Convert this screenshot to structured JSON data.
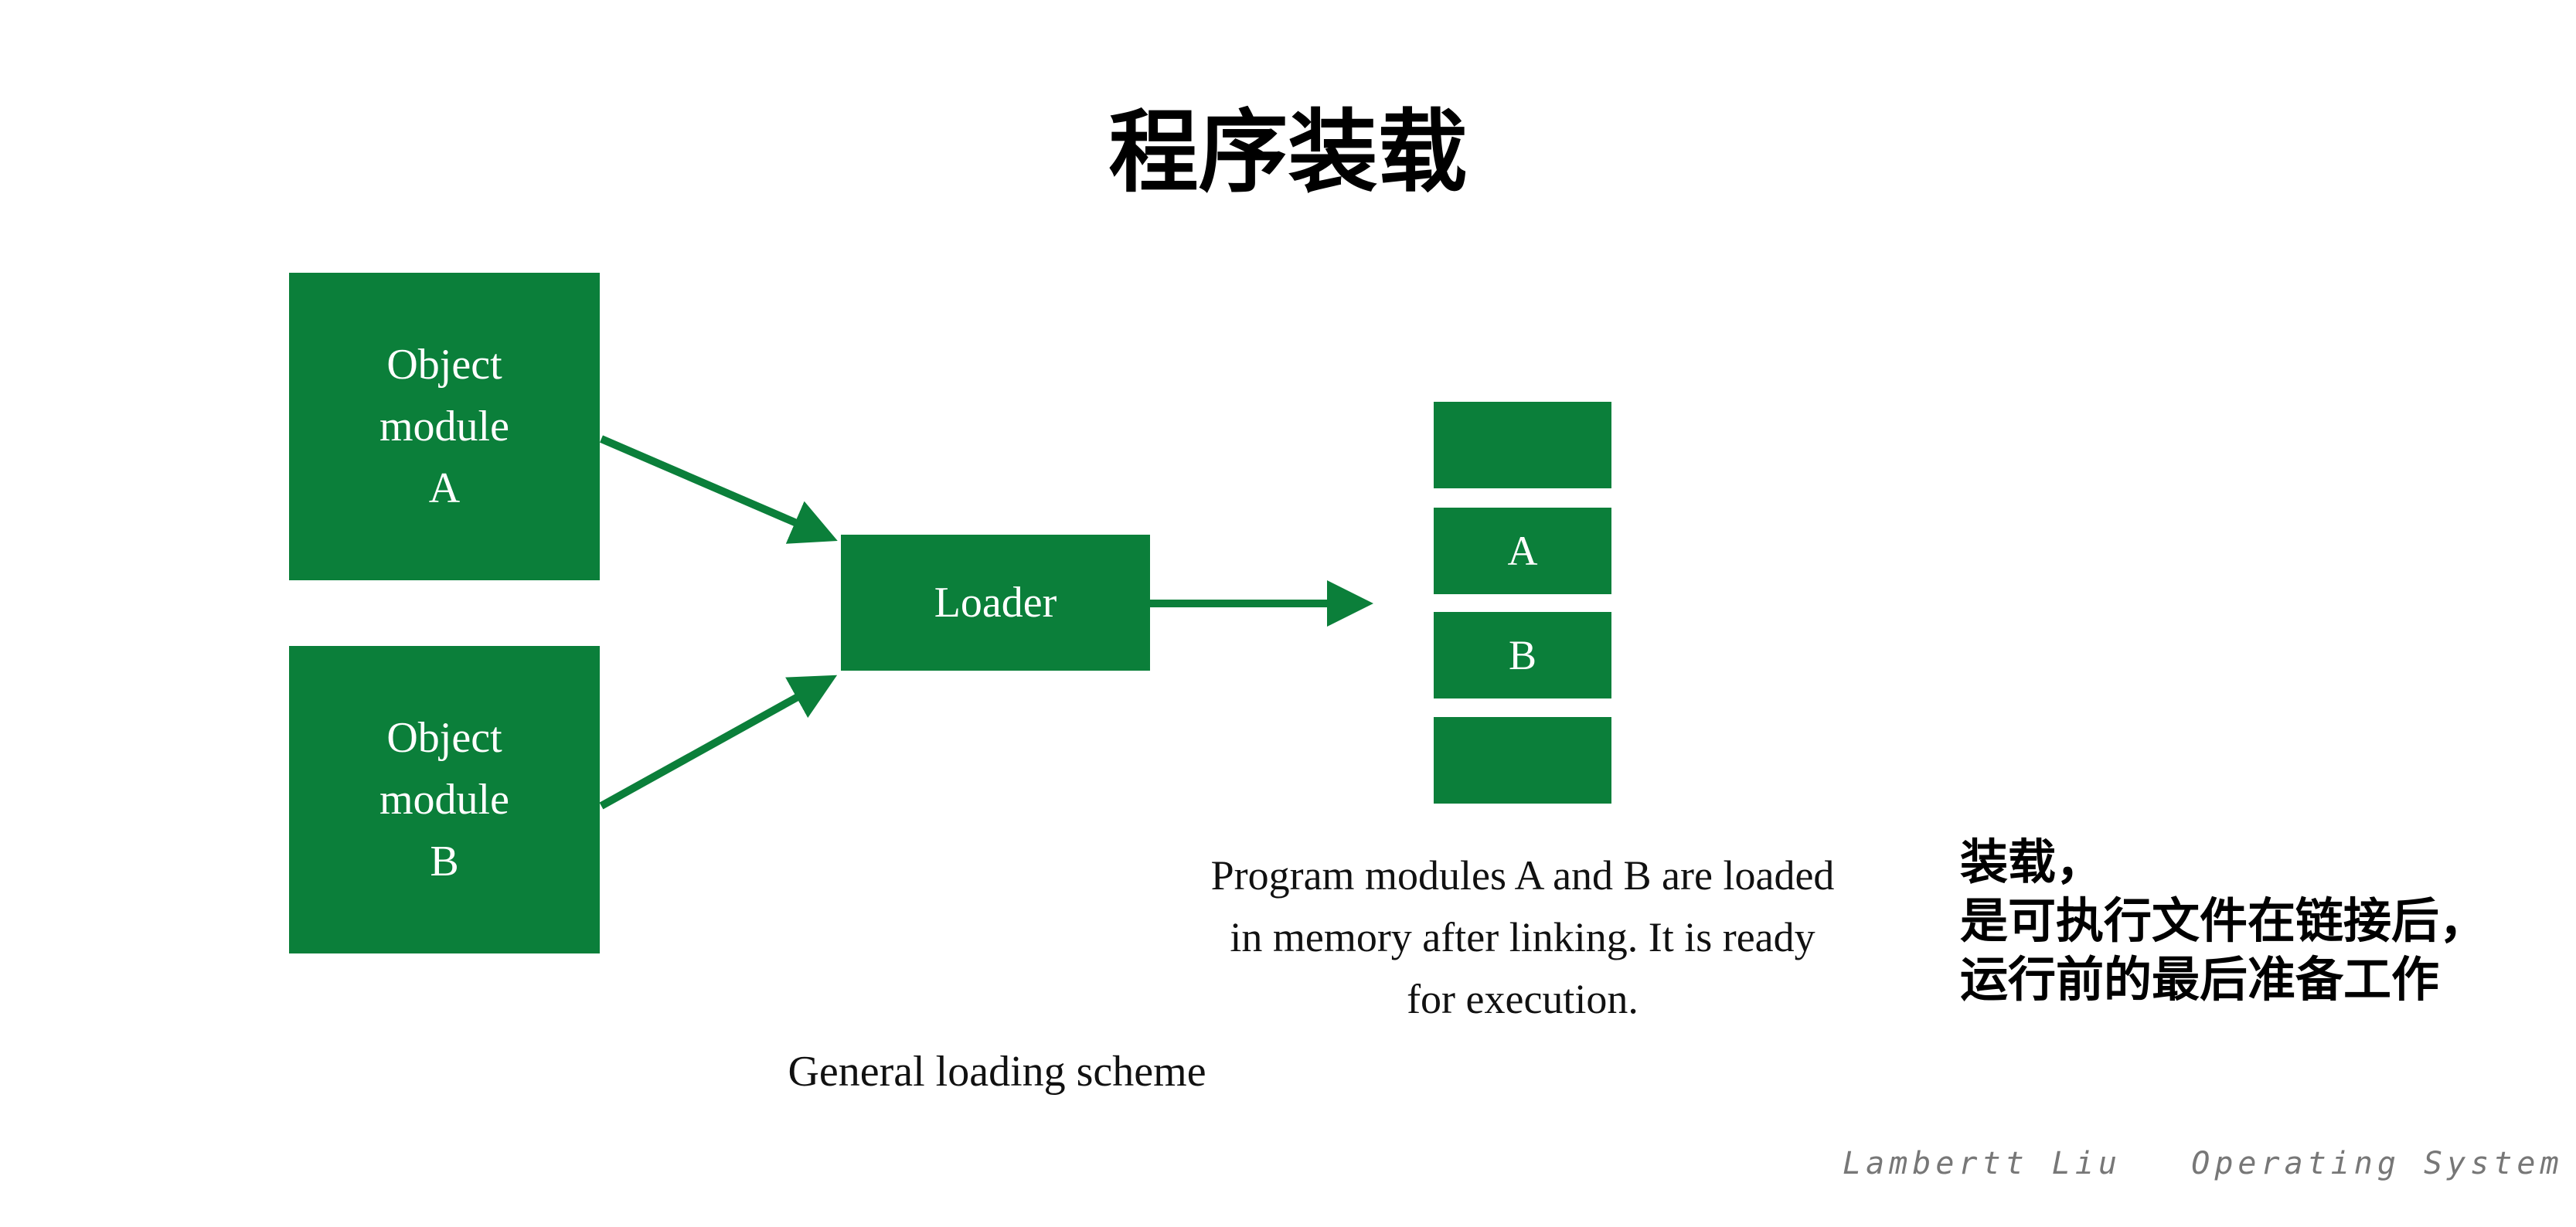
{
  "title": "程序装载",
  "modules": [
    {
      "line1": "Object",
      "line2": "module",
      "line3": "A"
    },
    {
      "line1": "Object",
      "line2": "module",
      "line3": "B"
    }
  ],
  "loader_label": "Loader",
  "memory_blocks": [
    "",
    "A",
    "B",
    ""
  ],
  "program_caption": {
    "line1": "Program modules A and B are loaded",
    "line2": "in memory after linking. It is ready",
    "line3": "for execution."
  },
  "general_caption": "General loading scheme",
  "note": {
    "line1": "装载，",
    "line2": "是可执行文件在链接后，",
    "line3": "运行前的最后准备工作"
  },
  "footer": {
    "author": "Lambertt Liu",
    "course": "Operating System"
  },
  "colors": {
    "box_green": "#0b7f3a",
    "arrow_green": "#0b7f3a"
  }
}
